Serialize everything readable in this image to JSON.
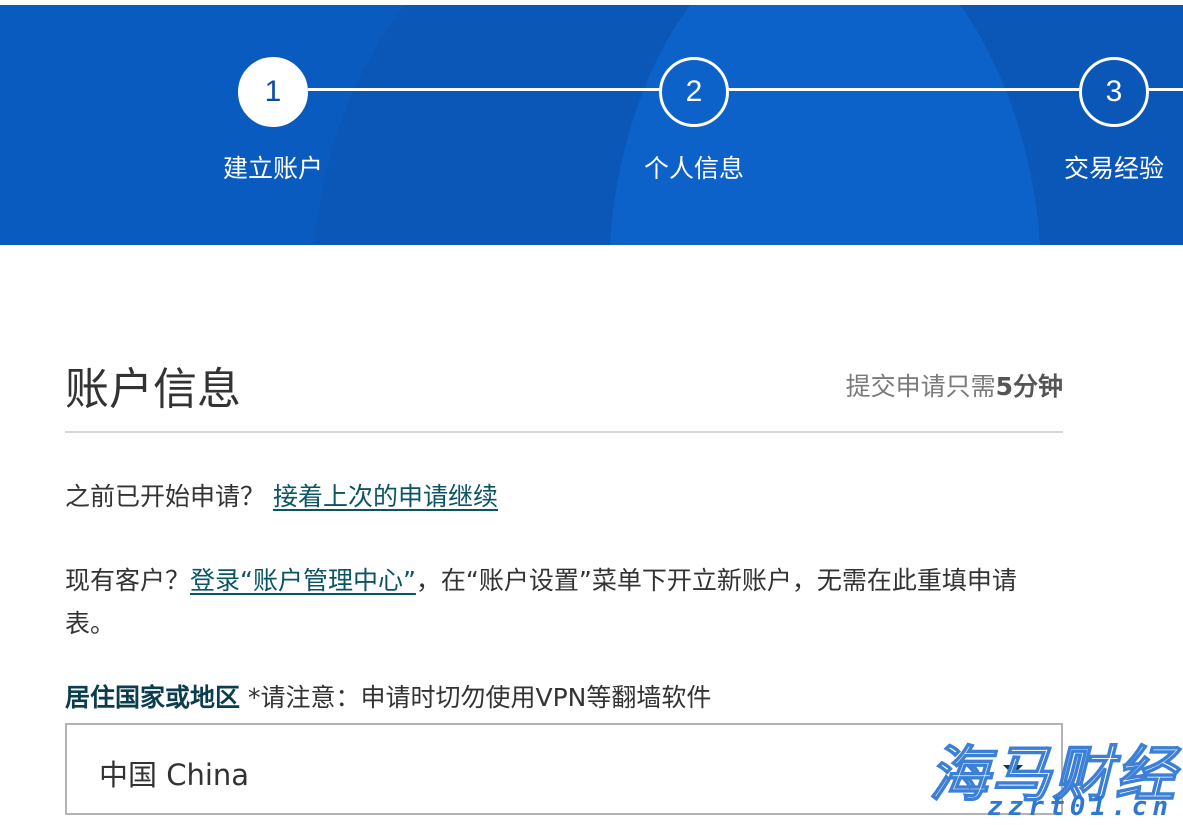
{
  "stepper": {
    "steps": [
      {
        "number": "1",
        "label": "建立账户",
        "state": "active"
      },
      {
        "number": "2",
        "label": "个人信息",
        "state": "pending"
      },
      {
        "number": "3",
        "label": "交易经验",
        "state": "pending"
      }
    ]
  },
  "header": {
    "title": "账户信息",
    "duration_prefix": "提交申请只需",
    "duration_value": "5分钟"
  },
  "resume": {
    "text": "之前已开始申请？",
    "link": "接着上次的申请继续"
  },
  "existing": {
    "prefix": "现有客户？",
    "link": "登录“账户管理中心”",
    "suffix": "，在“账户设置”菜单下开立新账户，无需在此重填申请表。"
  },
  "residence": {
    "label": "居住国家或地区",
    "note": " *请注意：申请时切勿使用VPN等翻墙软件",
    "selected": "中国 China"
  },
  "watermark": {
    "main": "海马财经",
    "sub": "zzrt01.cn"
  },
  "colors": {
    "banner_blue": "#0a5bbf",
    "link_teal": "#0b5563",
    "label_dark": "#0a3d4d"
  }
}
